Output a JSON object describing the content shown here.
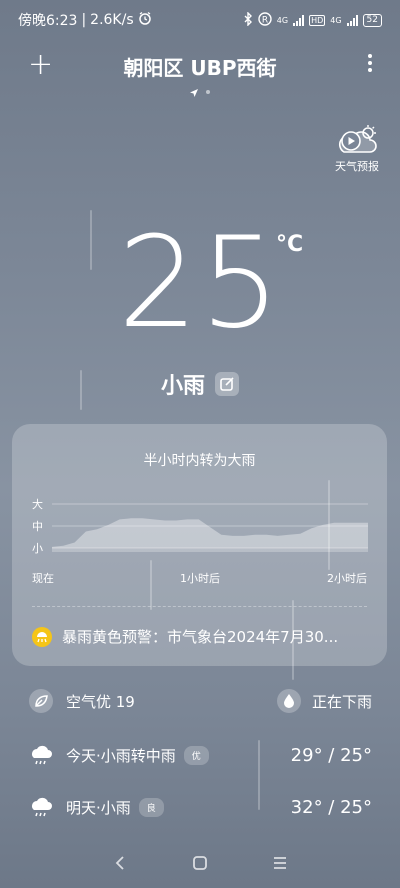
{
  "status_bar": {
    "time": "傍晚6:23",
    "separator": "|",
    "net_speed": "2.6K/s",
    "sim1_tag": "4G",
    "hd_tag": "HD",
    "sim2_tag": "4G",
    "battery": "52"
  },
  "header": {
    "location": "朝阳区 UBP西街"
  },
  "forecast_button": {
    "label": "天气预报"
  },
  "current": {
    "temperature": "25",
    "unit": "°C",
    "condition": "小雨"
  },
  "rain_card": {
    "title": "半小时内转为大雨",
    "y_labels": [
      "大",
      "中",
      "小"
    ],
    "x_labels": [
      "现在",
      "1小时后",
      "2小时后"
    ],
    "alert_text": "暴雨黄色预警：市气象台2024年7月30..."
  },
  "chart_data": {
    "type": "area",
    "title": "半小时内转为大雨",
    "categories_note_free": true,
    "x": [
      "现在",
      "1小时后",
      "2小时后"
    ],
    "y_levels": [
      "小",
      "中",
      "大"
    ],
    "series": [
      {
        "values": [
          0.05,
          0.1,
          0.25,
          0.75,
          0.85,
          1.05,
          1.3,
          1.35,
          1.35,
          1.3,
          1.25,
          1.25,
          1.3,
          1.3,
          0.95,
          0.6,
          0.55,
          0.55,
          0.6,
          0.6,
          0.55,
          0.6,
          0.65,
          0.9,
          1.05,
          1.15,
          1.15,
          1.15,
          1.15
        ]
      }
    ]
  },
  "air": {
    "label": "空气优 19",
    "rain_status": "正在下雨"
  },
  "days": [
    {
      "label": "今天·小雨转中雨",
      "aqi": "优",
      "temps": "29° / 25°"
    },
    {
      "label": "明天·小雨",
      "aqi": "良",
      "temps": "32° / 25°"
    }
  ],
  "colors": {
    "warning": "#f5c518"
  }
}
